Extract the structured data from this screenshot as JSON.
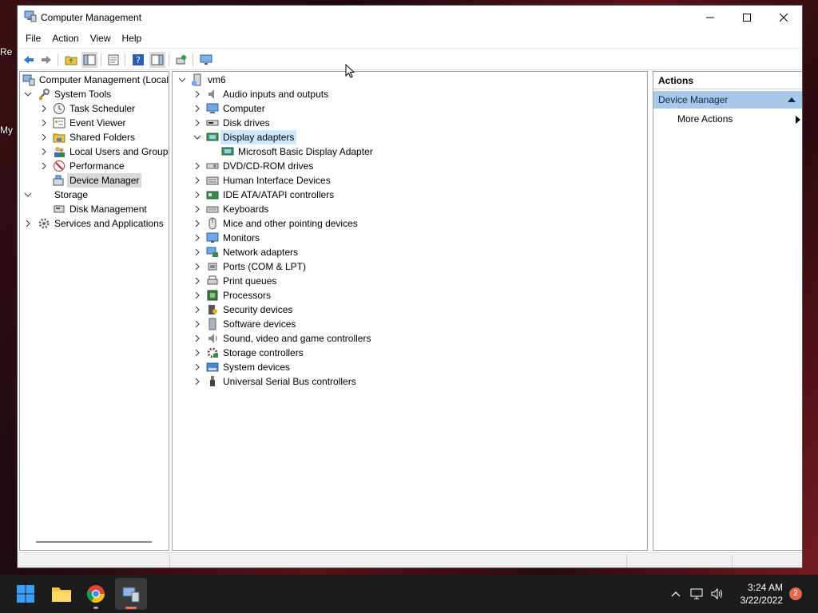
{
  "desktop": {
    "frag1": "Re",
    "frag2": "My"
  },
  "window": {
    "title": "Computer Management"
  },
  "menu": [
    "File",
    "Action",
    "View",
    "Help"
  ],
  "left_tree": {
    "root": "Computer Management (Local",
    "system_tools": "System Tools",
    "task_scheduler": "Task Scheduler",
    "event_viewer": "Event Viewer",
    "shared_folders": "Shared Folders",
    "local_users": "Local Users and Groups",
    "performance": "Performance",
    "device_manager": "Device Manager",
    "storage": "Storage",
    "disk_management": "Disk Management",
    "services_apps": "Services and Applications"
  },
  "device_tree": {
    "root": "vm6",
    "display_child": "Microsoft Basic Display Adapter",
    "categories": [
      "Audio inputs and outputs",
      "Computer",
      "Disk drives",
      "Display adapters",
      "DVD/CD-ROM drives",
      "Human Interface Devices",
      "IDE ATA/ATAPI controllers",
      "Keyboards",
      "Mice and other pointing devices",
      "Monitors",
      "Network adapters",
      "Ports (COM & LPT)",
      "Print queues",
      "Processors",
      "Security devices",
      "Software devices",
      "Sound, video and game controllers",
      "Storage controllers",
      "System devices",
      "Universal Serial Bus controllers"
    ]
  },
  "actions": {
    "header": "Actions",
    "section": "Device Manager",
    "more": "More Actions"
  },
  "taskbar": {
    "time": "3:24 AM",
    "date": "3/22/2022",
    "badge": "2"
  },
  "colors": {
    "selection": "#cce8ff",
    "actions_header": "#a8c8e8",
    "taskbar": "#1c1c1c",
    "accent": "#0078d4"
  }
}
